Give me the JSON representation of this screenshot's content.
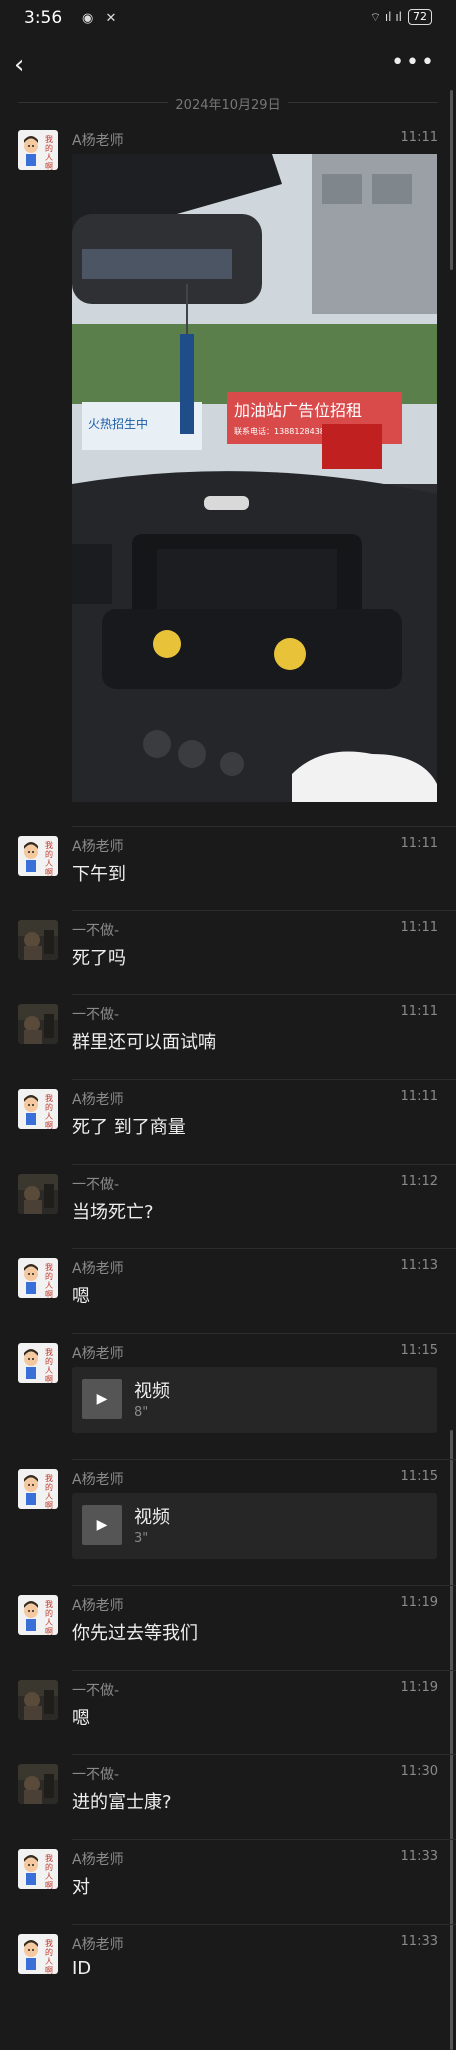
{
  "status": {
    "time": "3:56",
    "left_icons": "◉ ✕",
    "right_icons": "⌔ ıl ıl",
    "battery": "72"
  },
  "date_label": "2024年10月29日",
  "messages": [
    {
      "sender": "A杨老师",
      "time": "11:11",
      "type": "image",
      "text": ""
    },
    {
      "sender": "A杨老师",
      "time": "11:11",
      "type": "text",
      "text": "下午到"
    },
    {
      "sender": "一不做-",
      "time": "11:11",
      "type": "text",
      "text": "死了吗"
    },
    {
      "sender": "一不做-",
      "time": "11:11",
      "type": "text",
      "text": "群里还可以面试喃"
    },
    {
      "sender": "A杨老师",
      "time": "11:11",
      "type": "text",
      "text": "死了 到了商量"
    },
    {
      "sender": "一不做-",
      "time": "11:12",
      "type": "text",
      "text": "当场死亡?"
    },
    {
      "sender": "A杨老师",
      "time": "11:13",
      "type": "text",
      "text": "嗯"
    },
    {
      "sender": "A杨老师",
      "time": "11:15",
      "type": "video",
      "title": "视频",
      "duration": "8\""
    },
    {
      "sender": "A杨老师",
      "time": "11:15",
      "type": "video",
      "title": "视频",
      "duration": "3\""
    },
    {
      "sender": "A杨老师",
      "time": "11:19",
      "type": "text",
      "text": "你先过去等我们"
    },
    {
      "sender": "一不做-",
      "time": "11:19",
      "type": "text",
      "text": "嗯"
    },
    {
      "sender": "一不做-",
      "time": "11:30",
      "type": "text",
      "text": "进的富士康?"
    },
    {
      "sender": "A杨老师",
      "time": "11:33",
      "type": "text",
      "text": "对"
    },
    {
      "sender": "A杨老师",
      "time": "11:33",
      "type": "text",
      "text": "ID"
    }
  ],
  "photo_signs": {
    "left_sign": "火热招生中",
    "right_sign": "加油站广告位招租",
    "right_sign_sub": "联系电话：13881284381"
  },
  "avatar_teacher_text": "我\n的\n人\n啊",
  "colors": {
    "background": "#1a1a1a",
    "text": "#e6e6e6",
    "muted": "#8a8a8a"
  }
}
